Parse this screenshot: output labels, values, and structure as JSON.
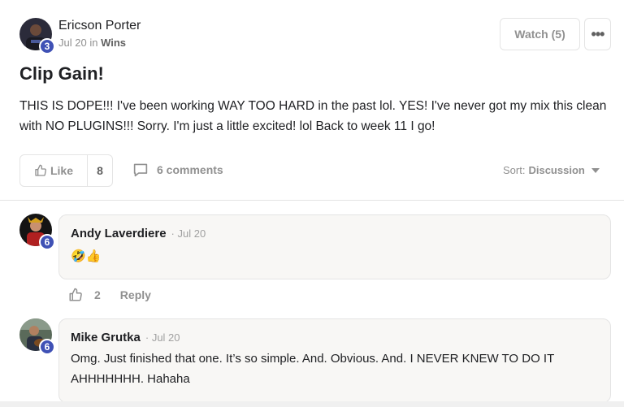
{
  "post": {
    "author": "Ericson Porter",
    "author_level": "3",
    "date": "Jul 20",
    "in_word": "in",
    "category": "Wins",
    "title": "Clip Gain!",
    "body": "THIS IS DOPE!!! I've been working WAY TOO HARD in the past lol. YES! I've never got my mix this clean with NO PLUGINS!!! Sorry. I'm just a little excited! lol Back to week 11 I go!",
    "watch_label": "Watch (5)",
    "more_label": "•••",
    "like_label": "Like",
    "like_count": "8",
    "comments_label": "6 comments",
    "sort_label": "Sort:",
    "sort_value": "Discussion"
  },
  "comments": [
    {
      "author": "Andy Laverdiere",
      "level": "6",
      "date": "· Jul 20",
      "text": "🤣👍",
      "likes": "2",
      "reply_label": "Reply"
    },
    {
      "author": "Mike Grutka",
      "level": "6",
      "date": "· Jul 20",
      "text": "Omg. Just finished that one. It’s so simple. And. Obvious. And. I NEVER KNEW TO DO IT AHHHHHHH. Hahaha"
    }
  ],
  "colors": {
    "level_badge": "#3f51b5",
    "muted_text": "#909090",
    "bubble_bg": "#f8f7f5"
  }
}
